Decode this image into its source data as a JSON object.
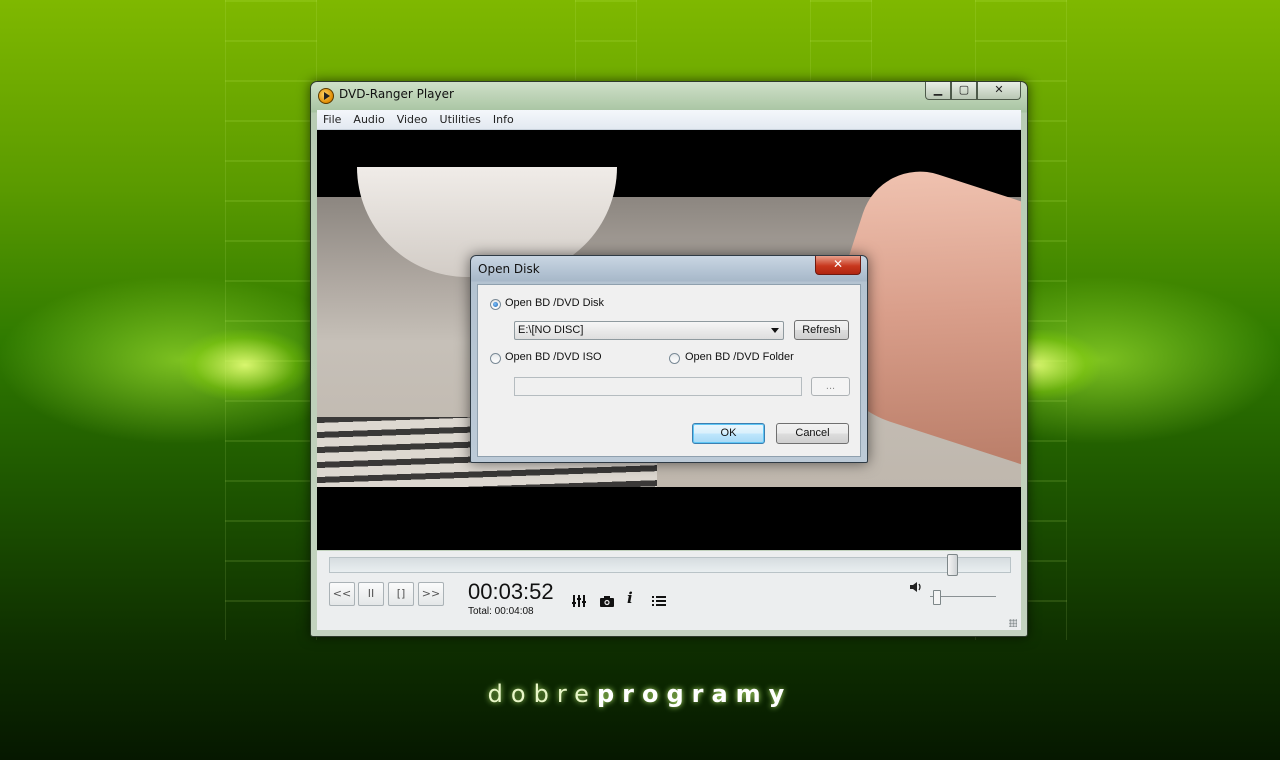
{
  "window": {
    "title": "DVD-Ranger Player",
    "controls": {
      "minimize": "▁",
      "maximize": "▢",
      "close": "✕"
    }
  },
  "menu": [
    "File",
    "Audio",
    "Video",
    "Utilities",
    "Info"
  ],
  "player": {
    "seek_position": 0.923,
    "volume_level": 0.05,
    "buttons": {
      "prev": "<<",
      "pause": "II",
      "stop": "[]",
      "next": ">>"
    },
    "time_current": "00:03:52",
    "time_total": "Total: 00:04:08",
    "icons": [
      "equalizer-icon",
      "camera-icon",
      "info-icon",
      "playlist-icon",
      "speaker-icon"
    ]
  },
  "dialog": {
    "title": "Open Disk",
    "close": "✕",
    "option_disk": "Open BD /DVD Disk",
    "drive_value": "E:\\[NO DISC]",
    "refresh": "Refresh",
    "option_iso": "Open BD /DVD ISO",
    "option_folder": "Open BD /DVD Folder",
    "browse": "...",
    "ok": "OK",
    "cancel": "Cancel",
    "selected_option": "disk"
  },
  "brand": {
    "light": "dobre",
    "bold": "programy"
  },
  "colors": {
    "background_top": "#7fb800",
    "background_bottom": "#061800",
    "accent_blue": "#3c7fb1",
    "close_red": "#c8381e"
  }
}
